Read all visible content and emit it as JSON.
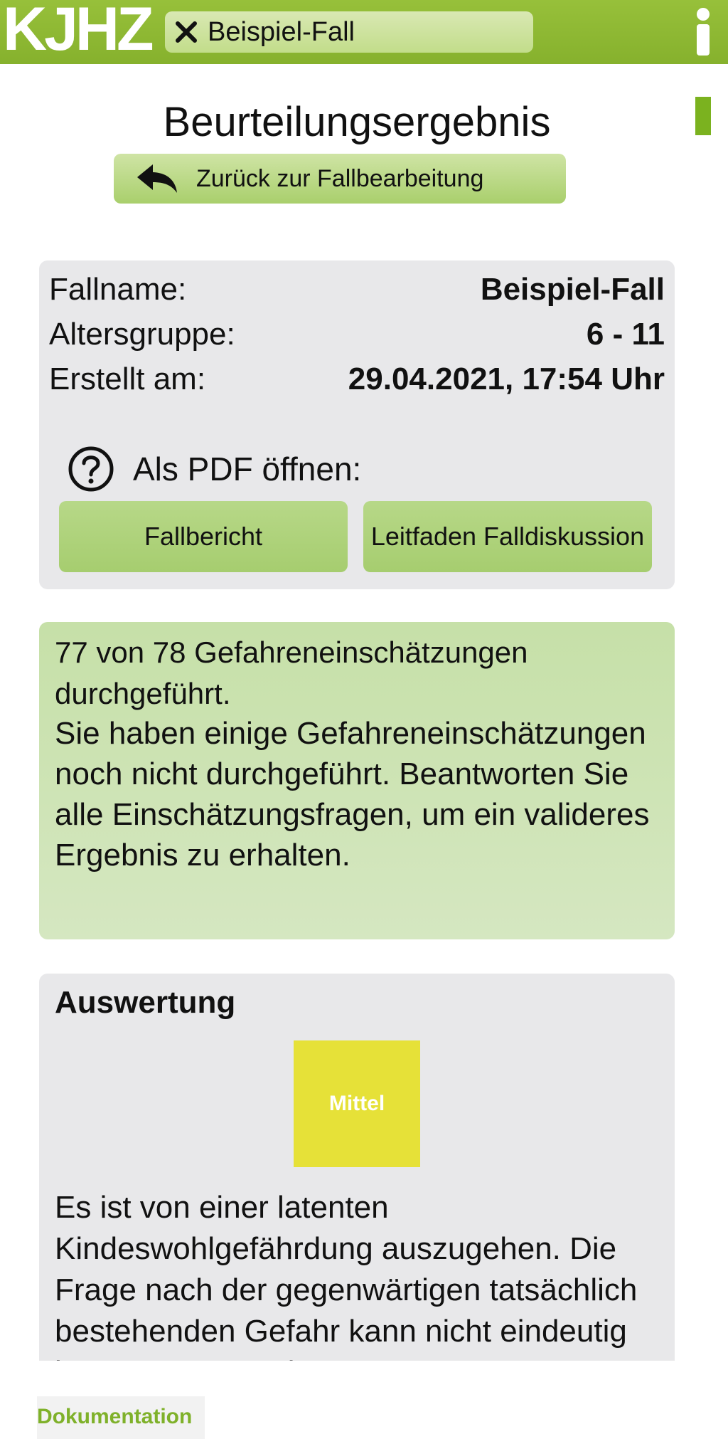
{
  "header": {
    "logo": "KJHZ",
    "case_tab_label": "Beispiel-Fall"
  },
  "page": {
    "title": "Beurteilungsergebnis",
    "back_label": "Zurück zur Fallbearbeitung"
  },
  "case_info": {
    "rows": [
      {
        "label": "Fallname:",
        "value": "Beispiel-Fall"
      },
      {
        "label": "Altersgruppe:",
        "value": "6 - 11"
      },
      {
        "label": "Erstellt am:",
        "value": "29.04.2021, 17:54 Uhr"
      }
    ],
    "pdf_label": "Als PDF öffnen:",
    "pdf_buttons": [
      "Fallbericht",
      "Leitfaden Falldiskussion"
    ]
  },
  "warning": {
    "headline": "77 von 78 Gefahreneinschätzungen durchgeführt.",
    "text": "Sie haben einige Gefahreneinschätzungen noch nicht durchgeführt. Beantworten Sie alle Einschätzungsfragen, um ein valideres Ergebnis zu erhalten."
  },
  "evaluation": {
    "heading": "Auswertung",
    "level": "Mittel",
    "level_color": "#e6e138",
    "text": "Es ist von einer latenten Kindeswohlgefährdung auszugehen. Die Frage nach der gegenwärtigen tatsächlich bestehenden Gefahr kann nicht eindeutig beantwortet werden."
  },
  "bottom_tabs": [
    "Dokumentation"
  ],
  "colors": {
    "brand_green": "#8bb833",
    "button_green": "#a9cf6c",
    "warning_bg": "#cde3b4",
    "card_bg": "#e8e8ea"
  },
  "icons": [
    "close-icon",
    "info-icon",
    "back-arrow-icon",
    "help-icon"
  ]
}
